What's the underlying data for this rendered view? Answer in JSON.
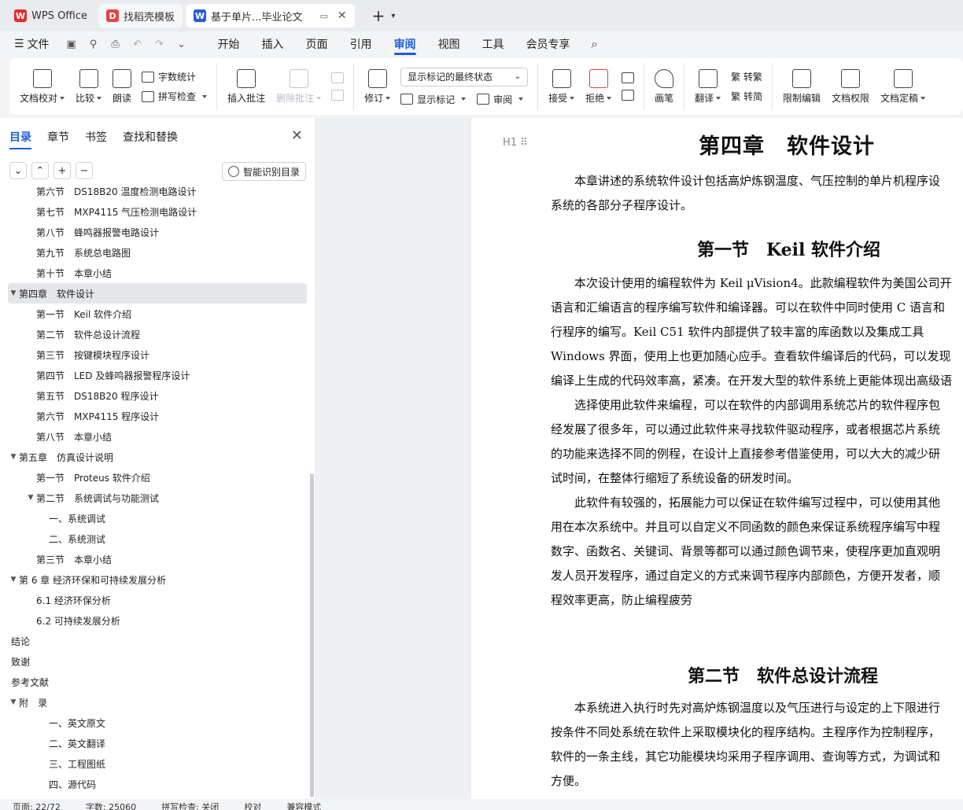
{
  "tabs": [
    {
      "label": "WPS Office",
      "icon": "wps-logo-icon",
      "color": "#e02d2d"
    },
    {
      "label": "找稻壳模板",
      "icon": "docer-logo-icon",
      "color": "#e54545"
    },
    {
      "label": "基于单片...毕业论文",
      "icon": "wps-writer-icon",
      "color": "#2a5bd7"
    }
  ],
  "menu": {
    "file": "文件",
    "items": [
      "开始",
      "插入",
      "页面",
      "引用",
      "审阅",
      "视图",
      "工具",
      "会员专享"
    ],
    "active": "审阅"
  },
  "ribbon": {
    "doc_proof": "文档校对",
    "compare": "比较",
    "read_aloud": "朗读",
    "word_count": "字数统计",
    "spell_check": "拼写检查",
    "insert_comment": "插入批注",
    "delete_comment": "删除批注",
    "revise": "修订",
    "markup_select": "显示标记的最终状态",
    "show_markup": "显示标记",
    "review": "审阅",
    "accept": "接受",
    "reject": "拒绝",
    "pen": "画笔",
    "translate": "翻译",
    "to_traditional": "繁 转繁",
    "to_simplified": "繁 转简",
    "restrict_edit": "限制编辑",
    "doc_permission": "文档权限",
    "finalize": "文档定稿"
  },
  "nav": {
    "tabs": [
      "目录",
      "章节",
      "书签",
      "查找和替换"
    ],
    "smart_toc": "智能识别目录",
    "toc": [
      {
        "label": "第六节　DS18B20 温度检测电路设计",
        "level": 1
      },
      {
        "label": "第七节　MXP4115 气压检测电路设计",
        "level": 1
      },
      {
        "label": "第八节　蜂鸣器报警电路设计",
        "level": 1
      },
      {
        "label": "第九节　系统总电路图",
        "level": 1
      },
      {
        "label": "第十节　本章小结",
        "level": 1
      },
      {
        "label": "第四章　软件设计",
        "level": 0,
        "caret": "▼",
        "selected": true
      },
      {
        "label": "第一节　Keil 软件介绍",
        "level": 1
      },
      {
        "label": "第二节　软件总设计流程",
        "level": 1
      },
      {
        "label": "第三节　按键模块程序设计",
        "level": 1
      },
      {
        "label": "第四节　LED 及蜂鸣器报警程序设计",
        "level": 1
      },
      {
        "label": "第五节　DS18B20 程序设计",
        "level": 1
      },
      {
        "label": "第六节　MXP4115 程序设计",
        "level": 1
      },
      {
        "label": "第八节　本章小结",
        "level": 1
      },
      {
        "label": "第五章　仿真设计说明",
        "level": 0,
        "caret": "▼"
      },
      {
        "label": "第一节　Proteus 软件介绍",
        "level": 1
      },
      {
        "label": "第二节　系统调试与功能测试",
        "level": 1,
        "caret": "▼"
      },
      {
        "label": "一、系统调试",
        "level": 2
      },
      {
        "label": "二、系统测试",
        "level": 2
      },
      {
        "label": "第三节　本章小结",
        "level": 1
      },
      {
        "label": "第 6 章  经济环保和可持续发展分析",
        "level": 0,
        "caret": "▼"
      },
      {
        "label": "6.1 经济环保分析",
        "level": 1
      },
      {
        "label": "6.2 可持续发展分析",
        "level": 1
      },
      {
        "label": "结论",
        "level": 0
      },
      {
        "label": "致谢",
        "level": 0
      },
      {
        "label": "参考文献",
        "level": 0
      },
      {
        "label": "附　录",
        "level": 0,
        "caret": "▼"
      },
      {
        "label": "一、英文原文",
        "level": 2
      },
      {
        "label": "二、英文翻译",
        "level": 2
      },
      {
        "label": "三、工程图纸",
        "level": 2
      },
      {
        "label": "四、源代码",
        "level": 2
      }
    ]
  },
  "doc": {
    "heading_mark": "H1",
    "chapter_title": "第四章　软件设计",
    "section1_title": "第一节　Keil 软件介绍",
    "section2_title": "第二节　软件总设计流程",
    "intro_lines": [
      "　　本章讲述的系统软件设计包括高炉炼钢温度、气压控制的单片机程序设",
      "系统的各部分子程序设计。"
    ],
    "section1_lines": [
      "　　本次设计使用的编程软件为 Keil μVision4。此款编程软件为美国公司开",
      "语言和汇编语言的程序编写软件和编译器。可以在软件中同时使用 C 语言和",
      "行程序的编写。Keil C51 软件内部提供了较丰富的库函数以及集成工具",
      "Windows 界面，使用上也更加随心应手。查看软件编译后的代码，可以发现",
      "编译上生成的代码效率高，紧凑。在开发大型的软件系统上更能体现出高级语",
      "　　选择使用此软件来编程，可以在软件的内部调用系统芯片的软件程序包",
      "经发展了很多年，可以通过此软件来寻找软件驱动程序，或者根据芯片系统",
      "的功能来选择不同的例程，在设计上直接参考借鉴使用，可以大大的减少研",
      "试时间，在整体行缩短了系统设备的研发时间。",
      "　　此软件有较强的，拓展能力可以保证在软件编写过程中，可以使用其他",
      "用在本次系统中。并且可以自定义不同函数的颜色来保证系统程序编写中程",
      "数字、函数名、关键词、背景等都可以通过颜色调节来，使程序更加直观明",
      "发人员开发程序，通过自定义的方式来调节程序内部颜色，方便开发者，顺",
      "程效率更高，防止编程疲劳"
    ],
    "section2_lines": [
      "　　本系统进入执行时先对高炉炼钢温度以及气压进行与设定的上下限进行",
      "按条件不同处系统在软件上采取模块化的程序结构。主程序作为控制程序，",
      "软件的一条主线，其它功能模块均采用子程序调用、查询等方式，为调试和",
      "方便。"
    ]
  },
  "status": {
    "page": "页面: 22/72",
    "words": "字数: 25060",
    "spell": "拼写检查: 关闭",
    "proof": "校对",
    "compat": "兼容模式"
  }
}
